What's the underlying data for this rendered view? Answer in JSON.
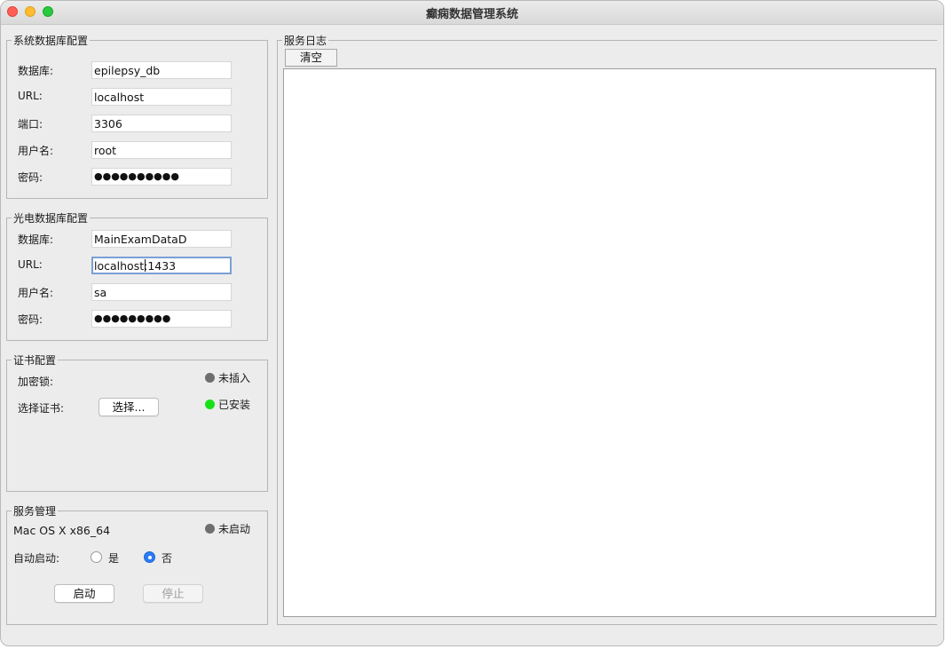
{
  "window": {
    "title": "癫痫数据管理系统"
  },
  "system_db": {
    "legend": "系统数据库配置",
    "db_label": "数据库:",
    "db_value": "epilepsy_db",
    "url_label": "URL:",
    "url_value": "localhost",
    "port_label": "端口:",
    "port_value": "3306",
    "user_label": "用户名:",
    "user_value": "root",
    "pwd_label": "密码:",
    "pwd_value": "●●●●●●●●●●"
  },
  "photo_db": {
    "legend": "光电数据库配置",
    "db_label": "数据库:",
    "db_value": "MainExamDataD",
    "url_label": "URL:",
    "url_value": "localhost:1433",
    "user_label": "用户名:",
    "user_value": "sa",
    "pwd_label": "密码:",
    "pwd_value": "●●●●●●●●●"
  },
  "cert": {
    "legend": "证书配置",
    "dongle_label": "加密锁:",
    "dongle_status": "未插入",
    "select_label": "选择证书:",
    "select_button": "选择...",
    "cert_status": "已安装"
  },
  "service": {
    "legend": "服务管理",
    "os_text": "Mac OS X x86_64",
    "status": "未启动",
    "autostart_label": "自动启动:",
    "yes_label": "是",
    "no_label": "否",
    "autostart_selected": "否",
    "start_button": "启动",
    "stop_button": "停止"
  },
  "log": {
    "legend": "服务日志",
    "clear_button": "清空",
    "content": ""
  },
  "colors": {
    "status_inactive": "#6e6e6e",
    "status_ok": "#17e017",
    "radio_selected": "#2b7bf5"
  }
}
